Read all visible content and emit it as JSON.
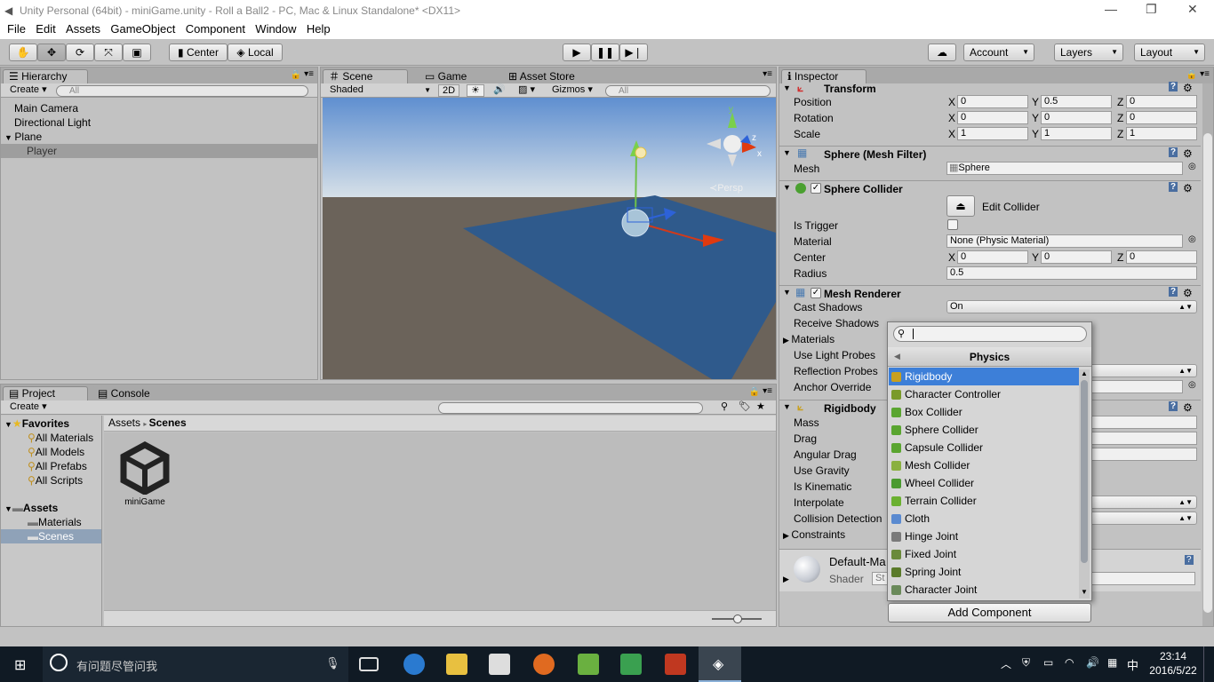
{
  "window": {
    "title": "Unity Personal (64bit) - miniGame.unity - Roll a Ball2 - PC, Mac & Linux Standalone* <DX11>"
  },
  "menu": [
    "File",
    "Edit",
    "Assets",
    "GameObject",
    "Component",
    "Window",
    "Help"
  ],
  "toolbar": {
    "pivot": "Center",
    "space": "Local",
    "account": "Account",
    "layers": "Layers",
    "layout": "Layout"
  },
  "hierarchy": {
    "tab": "Hierarchy",
    "create": "Create",
    "search_placeholder": "All",
    "items": [
      "Main Camera",
      "Directional Light",
      "Plane",
      "Player"
    ]
  },
  "scene": {
    "tabs": [
      "Scene",
      "Game",
      "Asset Store"
    ],
    "shading": "Shaded",
    "mode_2d": "2D",
    "gizmos": "Gizmos",
    "search_placeholder": "All",
    "persp": "Persp",
    "axis_y": "y",
    "axis_x": "x",
    "axis_z": "z"
  },
  "project": {
    "tabs": [
      "Project",
      "Console"
    ],
    "create": "Create",
    "favorites_title": "Favorites",
    "favorites": [
      "All Materials",
      "All Models",
      "All Prefabs",
      "All Scripts"
    ],
    "assets_title": "Assets",
    "folders": [
      "Materials",
      "Scenes"
    ],
    "breadcrumb": [
      "Assets",
      "Scenes"
    ],
    "files": [
      "miniGame"
    ]
  },
  "inspector": {
    "tab": "Inspector",
    "transform": {
      "title": "Transform",
      "rows": [
        {
          "label": "Position",
          "x": "0",
          "y": "0.5",
          "z": "0"
        },
        {
          "label": "Rotation",
          "x": "0",
          "y": "0",
          "z": "0"
        },
        {
          "label": "Scale",
          "x": "1",
          "y": "1",
          "z": "1"
        }
      ]
    },
    "axis_labels": [
      "X",
      "Y",
      "Z"
    ],
    "mesh_filter": {
      "title": "Sphere (Mesh Filter)",
      "label": "Mesh",
      "value": "Sphere"
    },
    "sphere_collider": {
      "title": "Sphere Collider",
      "edit": "Edit Collider",
      "is_trigger": "Is Trigger",
      "material": "Material",
      "material_value": "None (Physic Material)",
      "center": "Center",
      "center_x": "0",
      "center_y": "0",
      "center_z": "0",
      "radius": "Radius",
      "radius_value": "0.5"
    },
    "mesh_renderer": {
      "title": "Mesh Renderer",
      "rows": [
        "Cast Shadows",
        "Receive Shadows",
        "Materials",
        "Use Light Probes",
        "Reflection Probes",
        "Anchor Override"
      ],
      "cast_shadows_value": "On"
    },
    "rigidbody": {
      "title": "Rigidbody",
      "rows": [
        "Mass",
        "Drag",
        "Angular Drag",
        "Use Gravity",
        "Is Kinematic",
        "Interpolate",
        "Collision Detection",
        "Constraints"
      ]
    },
    "material": {
      "name": "Default-Ma",
      "shader_label": "Shader",
      "shader_value": "St"
    },
    "add_component": "Add Component"
  },
  "popup": {
    "title": "Physics",
    "items": [
      {
        "label": "Rigidbody",
        "icon": "rigidbody-icon",
        "color": "#c8a020"
      },
      {
        "label": "Character Controller",
        "icon": "character-controller-icon",
        "color": "#7a9a2a"
      },
      {
        "label": "Box Collider",
        "icon": "box-collider-icon",
        "color": "#5aa530"
      },
      {
        "label": "Sphere Collider",
        "icon": "sphere-collider-icon",
        "color": "#5aa530"
      },
      {
        "label": "Capsule Collider",
        "icon": "capsule-collider-icon",
        "color": "#5aa530"
      },
      {
        "label": "Mesh Collider",
        "icon": "mesh-collider-icon",
        "color": "#8ab040"
      },
      {
        "label": "Wheel Collider",
        "icon": "wheel-collider-icon",
        "color": "#4a9a30"
      },
      {
        "label": "Terrain Collider",
        "icon": "terrain-collider-icon",
        "color": "#6ab030"
      },
      {
        "label": "Cloth",
        "icon": "cloth-icon",
        "color": "#5a8ad0"
      },
      {
        "label": "Hinge Joint",
        "icon": "hinge-joint-icon",
        "color": "#7a7a7a"
      },
      {
        "label": "Fixed Joint",
        "icon": "fixed-joint-icon",
        "color": "#6a8a3a"
      },
      {
        "label": "Spring Joint",
        "icon": "spring-joint-icon",
        "color": "#5a7a2a"
      },
      {
        "label": "Character Joint",
        "icon": "character-joint-icon",
        "color": "#6a8a5a"
      }
    ]
  },
  "taskbar": {
    "search": "有问题尽管问我",
    "time": "23:14",
    "date": "2016/5/22",
    "ime": "中"
  }
}
